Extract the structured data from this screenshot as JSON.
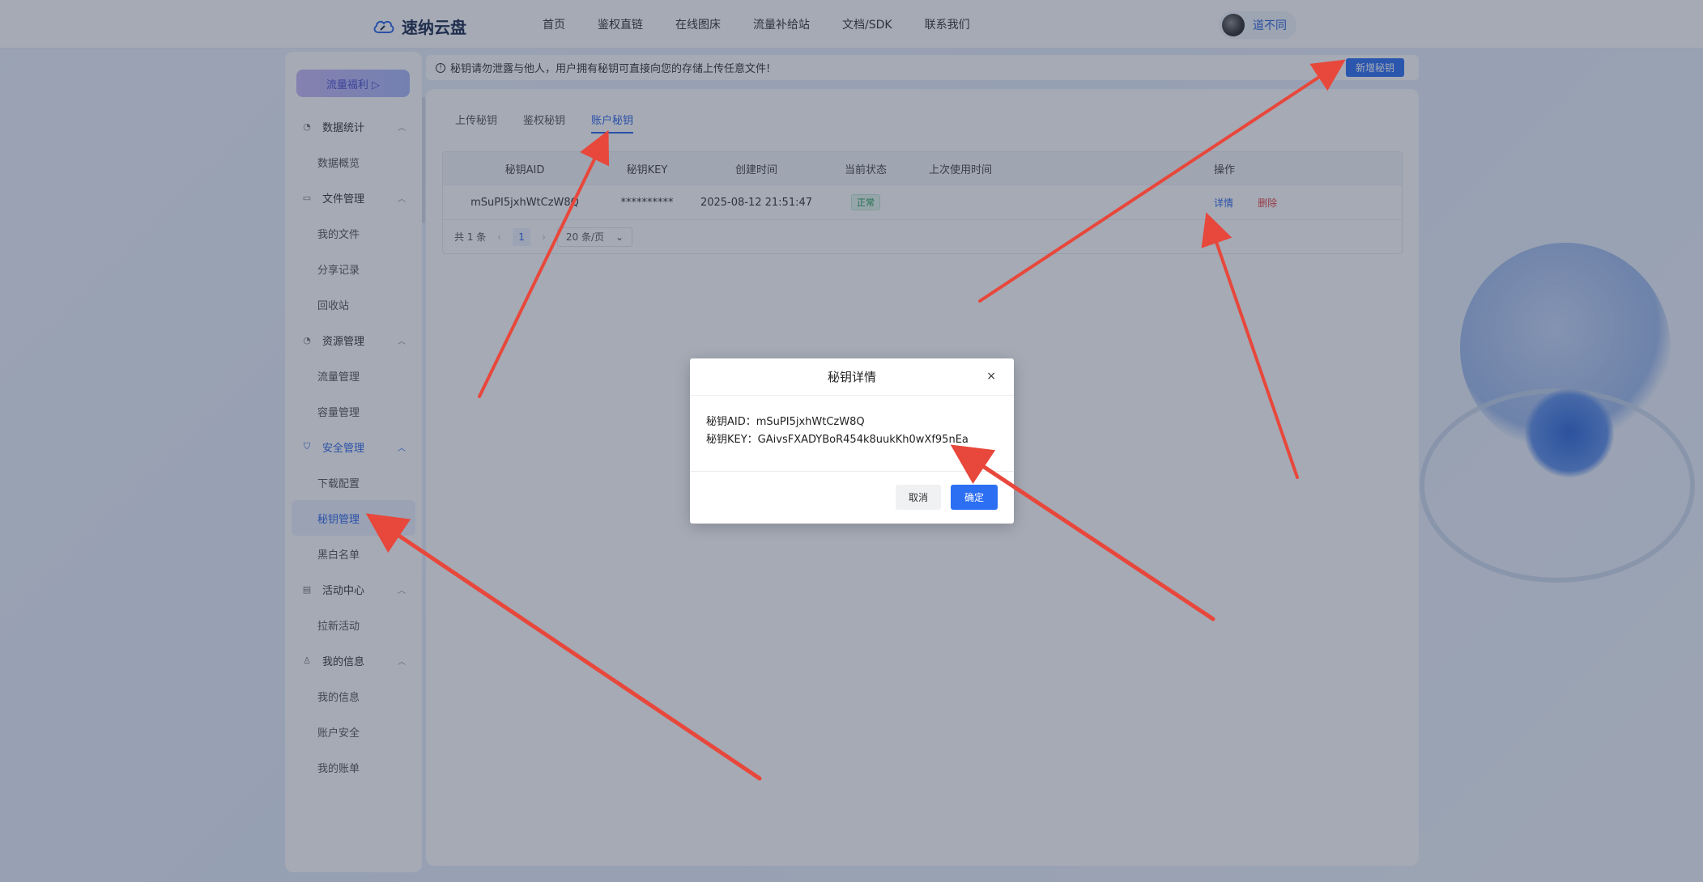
{
  "colors": {
    "accent": "#2d6ff3",
    "danger": "#e54545",
    "success": "#1e9c50",
    "annotation": "#e8473b"
  },
  "header": {
    "logo_text": "速纳云盘",
    "nav": [
      "首页",
      "鉴权直链",
      "在线图床",
      "流量补给站",
      "文档/SDK",
      "联系我们"
    ],
    "user_name": "道不同"
  },
  "sidebar": {
    "promo_label": "流量福利 ▷",
    "groups": [
      {
        "label": "数据统计",
        "icon": "dashboard-icon",
        "items": [
          "数据概览"
        ]
      },
      {
        "label": "文件管理",
        "icon": "folder-icon",
        "items": [
          "我的文件",
          "分享记录",
          "回收站"
        ]
      },
      {
        "label": "资源管理",
        "icon": "gauge-icon",
        "items": [
          "流量管理",
          "容量管理"
        ]
      },
      {
        "label": "安全管理",
        "icon": "shield-icon",
        "items": [
          "下载配置",
          "秘钥管理",
          "黑白名单"
        ]
      },
      {
        "label": "活动中心",
        "icon": "calendar-icon",
        "items": [
          "拉新活动"
        ]
      },
      {
        "label": "我的信息",
        "icon": "user-icon",
        "items": [
          "我的信息",
          "账户安全",
          "我的账单"
        ]
      }
    ]
  },
  "notice": {
    "text": "秘钥请勿泄露与他人，用户拥有秘钥可直接向您的存储上传任意文件!",
    "new_button": "新增秘钥"
  },
  "tabs": [
    "上传秘钥",
    "鉴权秘钥",
    "账户秘钥"
  ],
  "active_tab": "账户秘钥",
  "table": {
    "columns": [
      "秘钥AID",
      "秘钥KEY",
      "创建时间",
      "当前状态",
      "上次使用时间",
      "操作"
    ],
    "rows": [
      {
        "aid": "mSuPI5jxhWtCzW8Q",
        "key": "**********",
        "created": "2025-08-12 21:51:47",
        "status": "正常",
        "last_used": "",
        "op_detail": "详情",
        "op_delete": "删除"
      }
    ],
    "pager": {
      "total": "共 1 条",
      "prev": "‹",
      "page": "1",
      "next": "›",
      "page_size": "20 条/页"
    }
  },
  "modal": {
    "title": "秘钥详情",
    "close": "×",
    "aid_line": "秘钥AID：mSuPI5jxhWtCzW8Q",
    "key_line": "秘钥KEY：GAivsFXADYBoR454k8uukKh0wXf95nEa",
    "cancel": "取消",
    "ok": "确定"
  }
}
